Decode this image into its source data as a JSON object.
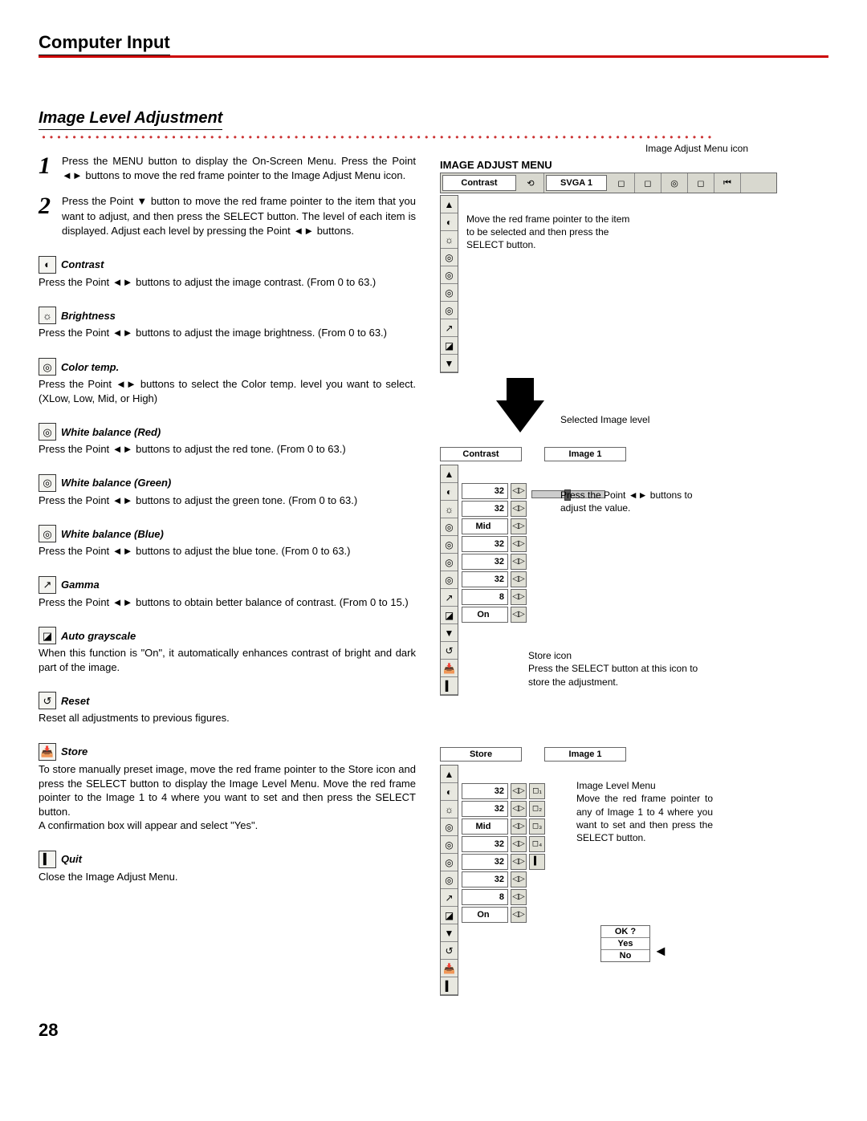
{
  "header": {
    "section": "Computer Input",
    "subtitle": "Image Level Adjustment"
  },
  "steps": {
    "1": "Press the MENU button to display the On-Screen Menu. Press the Point ◄► buttons to move the red frame pointer to the Image Adjust Menu icon.",
    "2": "Press the Point ▼ button to move the red frame pointer to the item that you want to adjust, and then press the SELECT button. The level of each item is displayed. Adjust each level by pressing the Point ◄► buttons."
  },
  "items": {
    "contrast": {
      "label": "Contrast",
      "desc": "Press the Point ◄► buttons to adjust the image contrast. (From 0 to 63.)"
    },
    "brightness": {
      "label": "Brightness",
      "desc": "Press the Point ◄► buttons to adjust the image brightness. (From 0 to 63.)"
    },
    "colortemp": {
      "label": "Color temp.",
      "desc": "Press the Point ◄► buttons to select the Color temp. level you want to select. (XLow, Low, Mid, or High)"
    },
    "wbr": {
      "label": "White balance (Red)",
      "desc": "Press the Point ◄► buttons to adjust the red tone.  (From 0 to 63.)"
    },
    "wbg": {
      "label": "White balance (Green)",
      "desc": "Press the Point ◄► buttons to adjust the green tone.  (From 0 to 63.)"
    },
    "wbb": {
      "label": "White balance (Blue)",
      "desc": "Press the Point ◄► buttons to adjust the blue tone.  (From 0 to 63.)"
    },
    "gamma": {
      "label": "Gamma",
      "desc": "Press the Point ◄► buttons to obtain better balance of contrast. (From 0 to 15.)"
    },
    "autogs": {
      "label": "Auto grayscale",
      "desc": "When this function is \"On\", it automatically enhances contrast of bright and dark part of the image."
    },
    "reset": {
      "label": "Reset",
      "desc": "Reset all adjustments to previous figures."
    },
    "store": {
      "label": "Store",
      "desc": "To store manually preset image, move the red frame pointer to the Store icon and press the SELECT button to display the Image Level Menu. Move the red frame pointer to the Image 1 to 4 where you want to set and then press the SELECT button.\nA confirmation box will appear and select \"Yes\"."
    },
    "quit": {
      "label": "Quit",
      "desc": "Close the Image Adjust Menu."
    }
  },
  "right": {
    "iconlabel": "Image Adjust Menu icon",
    "menuTitle": "IMAGE ADJUST MENU",
    "bar": {
      "name": "Contrast",
      "mode": "SVGA 1"
    },
    "annot1": "Move the red frame pointer to the item to be selected and then press the SELECT button.",
    "selectedLabel": "Selected Image level",
    "panel2": {
      "name": "Contrast",
      "mode": "Image 1",
      "rows": [
        {
          "icon": "◐",
          "val": "32"
        },
        {
          "icon": "☼",
          "val": "32"
        },
        {
          "icon": "◎",
          "val": "Mid"
        },
        {
          "icon": "◎",
          "val": "32"
        },
        {
          "icon": "◎",
          "val": "32"
        },
        {
          "icon": "◎",
          "val": "32"
        },
        {
          "icon": "↗",
          "val": "8"
        },
        {
          "icon": "◪",
          "val": "On"
        }
      ],
      "annotAdjust": "Press the Point ◄► buttons to adjust the value.",
      "storeNote1": "Store icon",
      "storeNote2": "Press the SELECT button at this icon to store the adjustment."
    },
    "panel3": {
      "name": "Store",
      "mode": "Image 1",
      "rows": [
        {
          "icon": "◐",
          "val": "32"
        },
        {
          "icon": "☼",
          "val": "32"
        },
        {
          "icon": "◎",
          "val": "Mid"
        },
        {
          "icon": "◎",
          "val": "32"
        },
        {
          "icon": "◎",
          "val": "32"
        },
        {
          "icon": "◎",
          "val": "32"
        },
        {
          "icon": "↗",
          "val": "8"
        },
        {
          "icon": "◪",
          "val": "On"
        }
      ],
      "imgLevelNote": "Image Level Menu\nMove the red frame pointer to any of Image 1 to 4 where you want to set and then press the SELECT button.",
      "ok": {
        "q": "OK ?",
        "yes": "Yes",
        "no": "No"
      }
    }
  },
  "pageNumber": "28"
}
